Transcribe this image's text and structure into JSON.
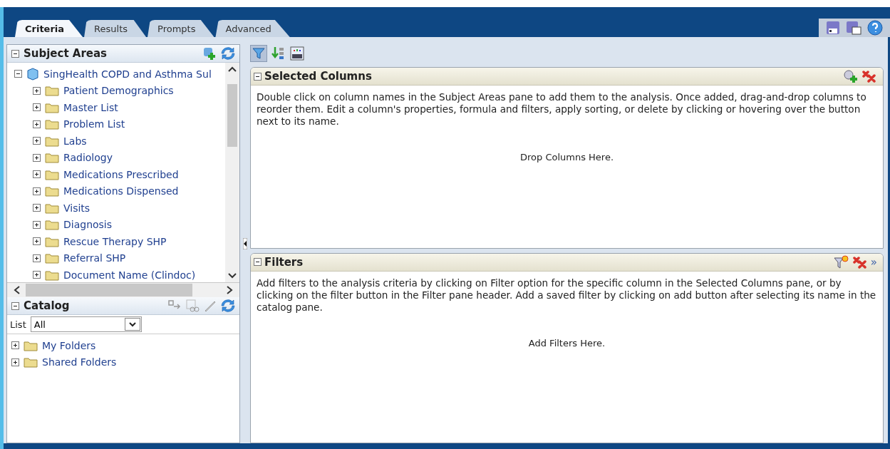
{
  "tabs": [
    {
      "label": "Criteria",
      "selected": true
    },
    {
      "label": "Results",
      "selected": false
    },
    {
      "label": "Prompts",
      "selected": false
    },
    {
      "label": "Advanced",
      "selected": false
    }
  ],
  "subject_areas": {
    "title": "Subject Areas",
    "expanded": true,
    "tree": [
      {
        "label": "SingHealth COPD and Asthma Sul",
        "expanded": true,
        "children": [
          {
            "label": "Patient Demographics",
            "expanded": false
          },
          {
            "label": "Master List",
            "expanded": false
          },
          {
            "label": "Problem List",
            "expanded": false
          },
          {
            "label": "Labs",
            "expanded": false
          },
          {
            "label": "Radiology",
            "expanded": false
          },
          {
            "label": "Medications Prescribed",
            "expanded": false
          },
          {
            "label": "Medications Dispensed",
            "expanded": false
          },
          {
            "label": "Visits",
            "expanded": false
          },
          {
            "label": "Diagnosis",
            "expanded": false
          },
          {
            "label": "Rescue Therapy SHP",
            "expanded": false
          },
          {
            "label": "Referral SHP",
            "expanded": false
          },
          {
            "label": "Document Name (Clindoc)",
            "expanded": false
          }
        ]
      }
    ]
  },
  "catalog": {
    "title": "Catalog",
    "expanded": true,
    "list_label": "List",
    "list_value": "All",
    "folders": [
      {
        "label": "My Folders",
        "expanded": false
      },
      {
        "label": "Shared Folders",
        "expanded": false
      }
    ]
  },
  "toolbar": [
    {
      "kind": "filter",
      "pressed": true
    },
    {
      "kind": "sort",
      "pressed": false
    },
    {
      "kind": "xyz",
      "pressed": false
    }
  ],
  "selected_columns": {
    "title": "Selected Columns",
    "expanded": true,
    "help": "Double click on column names in the Subject Areas pane to add them to the analysis. Once added, drag-and-drop columns to reorder them. Edit a column's properties, formula and filters, apply sorting, or delete by clicking or hovering over the button next to its name.",
    "drop_hint": "Drop Columns Here."
  },
  "filters": {
    "title": "Filters",
    "expanded": true,
    "help": "Add filters to the analysis criteria by clicking on Filter option for the specific column in the Selected Columns pane, or by clicking on the filter button in the Filter pane header. Add a saved filter by clicking on add button after selecting its name in the catalog pane.",
    "drop_hint": "Add Filters Here.",
    "more": "»"
  }
}
